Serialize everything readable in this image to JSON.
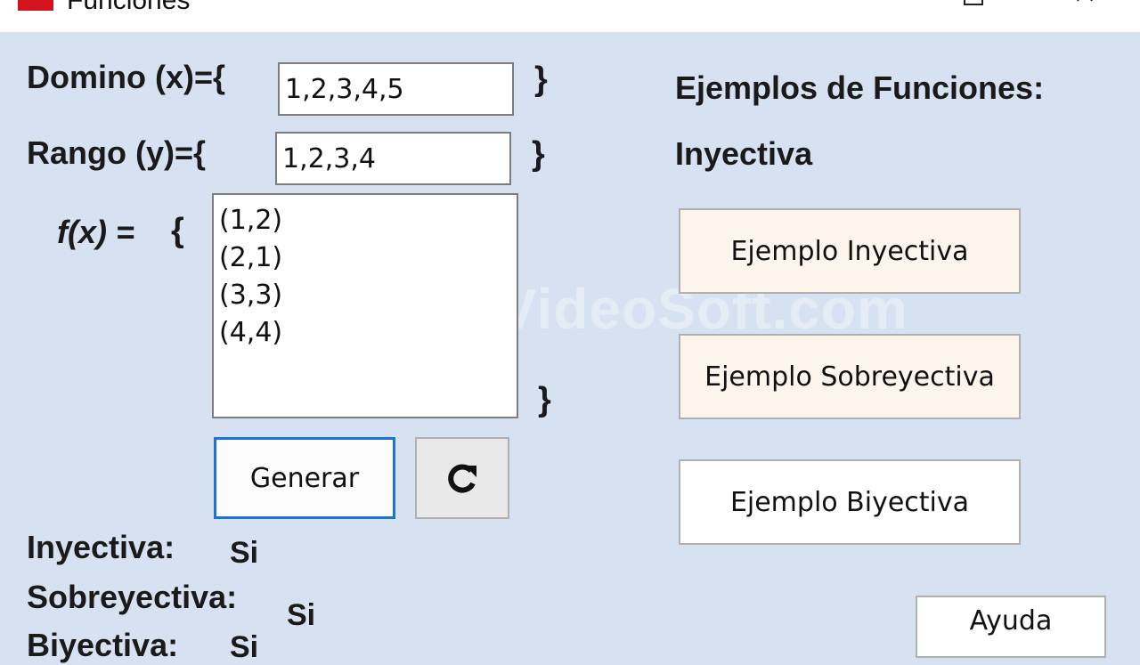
{
  "window": {
    "title": "Funciones",
    "icon": "app-icon",
    "maximize_icon": "maximize-icon",
    "close_icon": "close-icon",
    "close_glyph": "✕"
  },
  "form": {
    "domain_label": "Domino (x)={",
    "domain_value": "1,2,3,4,5",
    "range_label": "Rango (y)={",
    "range_value": "1,2,3,4",
    "close_brace": "}",
    "fx_label": "f(x) =",
    "open_brace": "{",
    "pairs": [
      "(1,2)",
      "(2,1)",
      "(3,3)",
      "(4,4)"
    ],
    "generate_label": "Generar",
    "refresh_icon": "refresh-icon"
  },
  "results": {
    "injective_label": "Inyectiva:",
    "injective_value": "Si",
    "surjective_label": "Sobreyectiva:",
    "surjective_value": "Si",
    "bijective_label": "Biyectiva:",
    "bijective_value": "Si"
  },
  "examples": {
    "heading": "Ejemplos de Funciones:",
    "current_type": "Inyectiva",
    "injective_button": "Ejemplo Inyectiva",
    "surjective_button": "Ejemplo Sobreyectiva",
    "bijective_button": "Ejemplo Biyectiva",
    "help_button": "Ayuda"
  },
  "watermark": "VideoSoft.com",
  "colors": {
    "background": "#d6e2f1",
    "focus_border": "#1b74d4",
    "app_icon": "#d4141c"
  }
}
